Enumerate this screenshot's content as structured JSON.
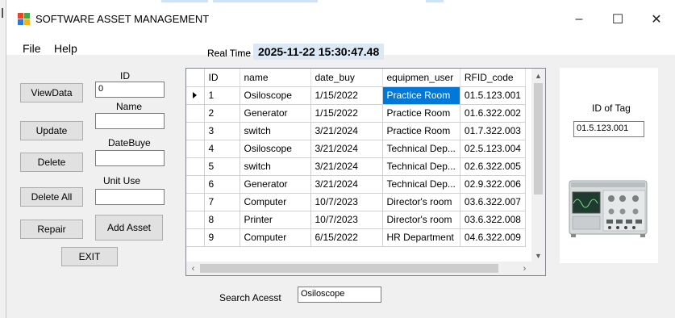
{
  "window": {
    "title": "SOFTWARE ASSET MANAGEMENT",
    "minimize_glyph": "–",
    "maximize_glyph": "☐",
    "close_glyph": "✕"
  },
  "menu": {
    "file": "File",
    "help": "Help"
  },
  "realtime": {
    "label": "Real Time",
    "value": "2025-11-22 15:30:47.48"
  },
  "form": {
    "id_label": "ID",
    "id_value": "0",
    "name_label": "Name",
    "name_value": "",
    "date_label": "DateBuye",
    "date_value": "",
    "unit_label": "Unit Use",
    "unit_value": ""
  },
  "buttons": {
    "view": "ViewData",
    "update": "Update",
    "delete": "Delete",
    "delete_all": "Delete All",
    "repair": "Repair",
    "add_asset": "Add Asset",
    "exit": "EXIT"
  },
  "grid": {
    "columns": [
      "ID",
      "name",
      "date_buy",
      "equipmen_user",
      "RFID_code"
    ],
    "rows": [
      [
        "1",
        "Osiloscope",
        "1/15/2022",
        "Practice Room",
        "01.5.123.001"
      ],
      [
        "2",
        "Generator",
        "1/15/2022",
        "Practice Room",
        "01.6.322.002"
      ],
      [
        "3",
        "switch",
        "3/21/2024",
        "Practice Room",
        "01.7.322.003"
      ],
      [
        "4",
        "Osiloscope",
        "3/21/2024",
        "Technical Dep...",
        "02.5.123.004"
      ],
      [
        "5",
        "switch",
        "3/21/2024",
        "Technical Dep...",
        "02.6.322.005"
      ],
      [
        "6",
        "Generator",
        "3/21/2024",
        "Technical Dep...",
        "02.9.322.006"
      ],
      [
        "7",
        "Computer",
        "10/7/2023",
        "Director's room",
        "03.6.322.007"
      ],
      [
        "8",
        "Printer",
        "10/7/2023",
        "Director's room",
        "03.6.322.008"
      ],
      [
        "9",
        "Computer",
        "6/15/2022",
        "HR Department",
        "04.6.322.009"
      ]
    ],
    "selected_row": 0,
    "selected_col": 3,
    "selection_color": "#0078d7"
  },
  "search": {
    "label": "Search Acesst",
    "value": "Osiloscope"
  },
  "tag": {
    "label": "ID of Tag",
    "value": "01.5.123.001"
  },
  "icons": {
    "app": "app-windows-icon",
    "device_image": "oscilloscope-image"
  }
}
